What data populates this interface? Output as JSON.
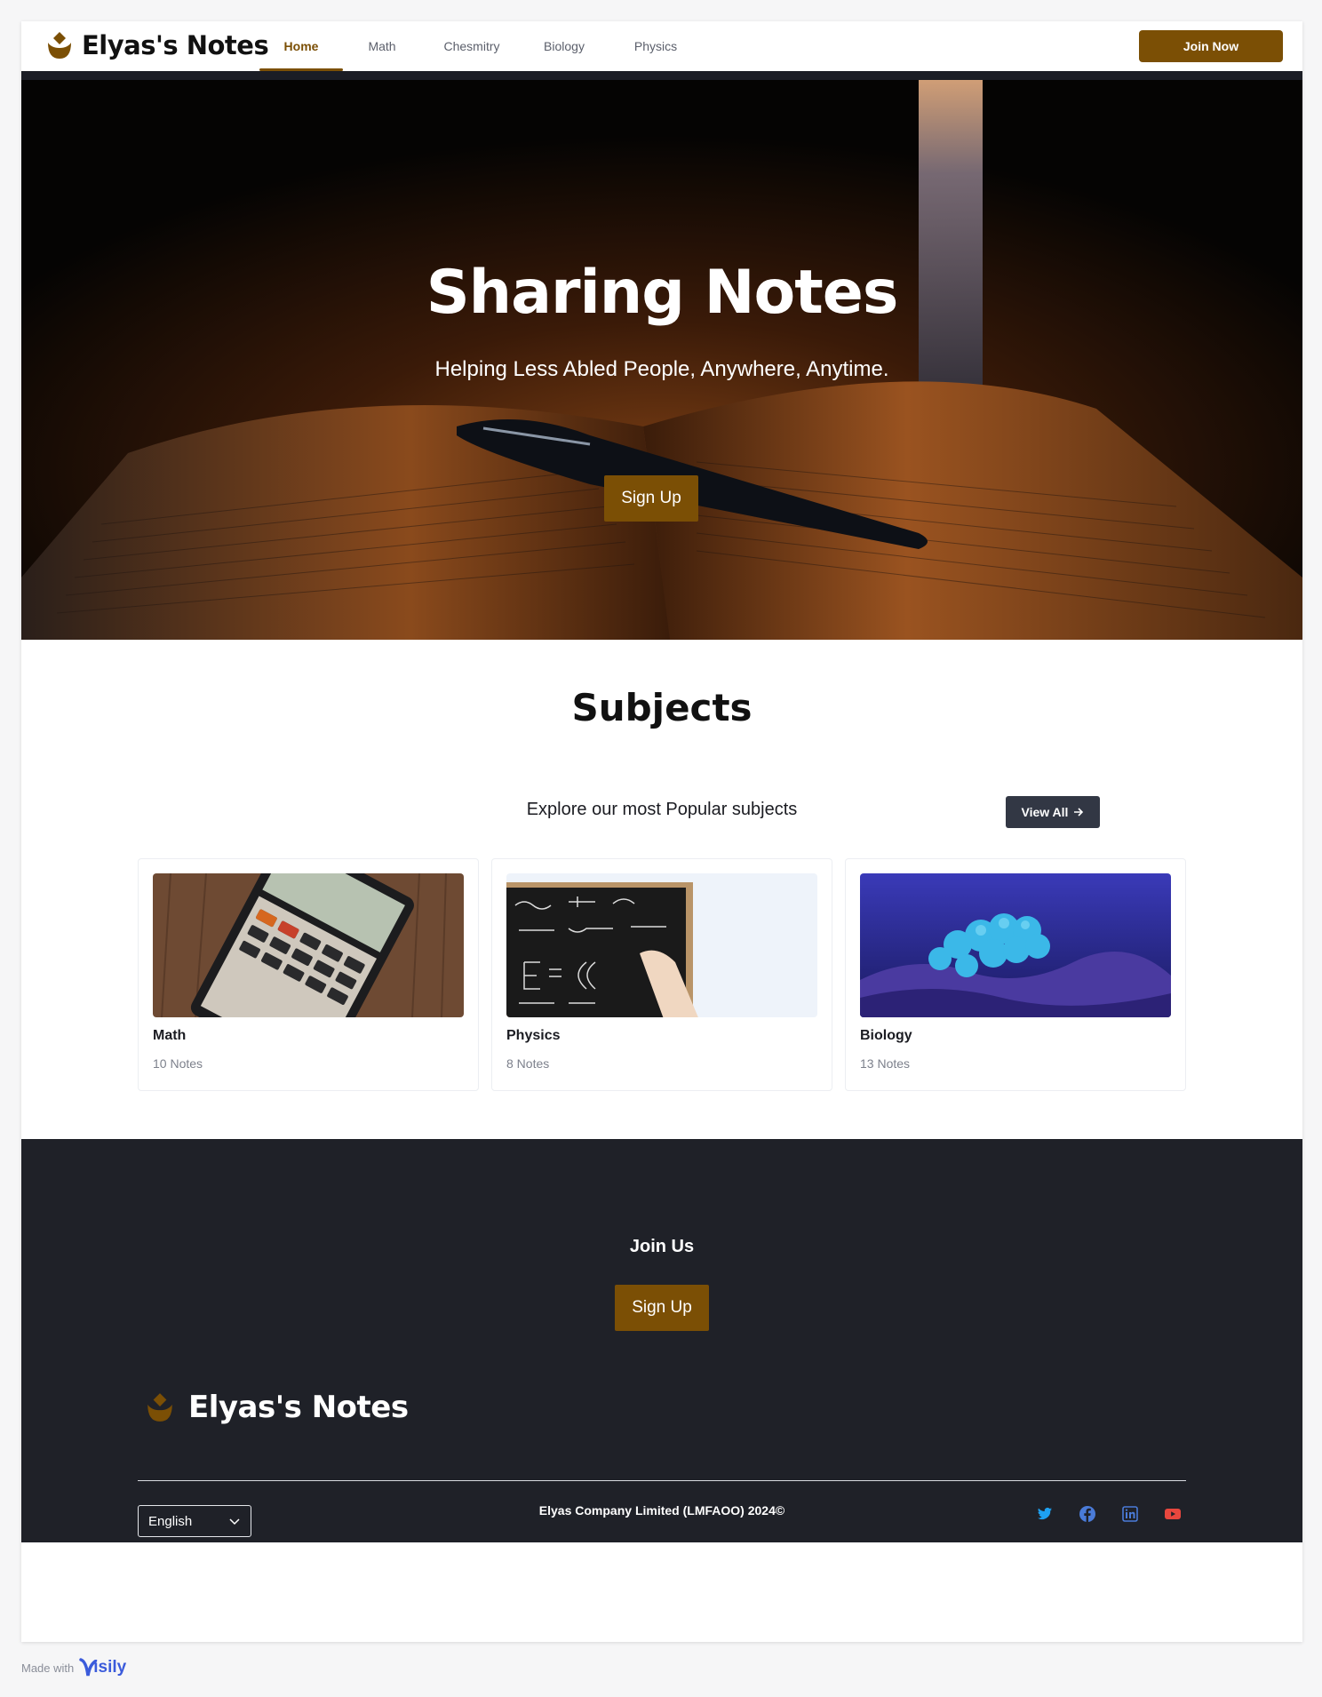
{
  "brand": {
    "name": "Elyas's Notes",
    "logo_icon": "brand-leaf-icon",
    "brand_color": "#7b4f05"
  },
  "nav": {
    "links": [
      {
        "label": "Home",
        "active": true
      },
      {
        "label": "Math",
        "active": false
      },
      {
        "label": "Chesmitry",
        "active": false
      },
      {
        "label": "Biology",
        "active": false
      },
      {
        "label": "Physics",
        "active": false
      }
    ],
    "join_label": "Join Now"
  },
  "hero": {
    "title": "Sharing Notes",
    "subtitle": "Helping Less Abled People, Anywhere, Anytime.",
    "signup_label": "Sign Up"
  },
  "subjects": {
    "title": "Subjects",
    "explore_text": "Explore our most Popular subjects",
    "view_all_label": "View All",
    "view_all_icon": "arrow-right-icon",
    "cards": [
      {
        "title": "Math",
        "count": "10 Notes"
      },
      {
        "title": "Physics",
        "count": "8 Notes"
      },
      {
        "title": "Biology",
        "count": "13 Notes"
      }
    ]
  },
  "footer": {
    "join_title": "Join Us",
    "signup_label": "Sign Up",
    "brand_name": "Elyas's Notes",
    "language": "English",
    "copyright": "Elyas Company Limited (LMFAOO) 2024©",
    "socials": [
      {
        "icon": "twitter-icon",
        "color": "#1da1f2"
      },
      {
        "icon": "facebook-icon",
        "color": "#4a7bd8"
      },
      {
        "icon": "linkedin-icon",
        "color": "#4a7bd8"
      },
      {
        "icon": "youtube-icon",
        "color": "#e8473e"
      }
    ],
    "background": "#1f2128"
  },
  "made_with": {
    "text": "Made with",
    "tool": "isily"
  }
}
